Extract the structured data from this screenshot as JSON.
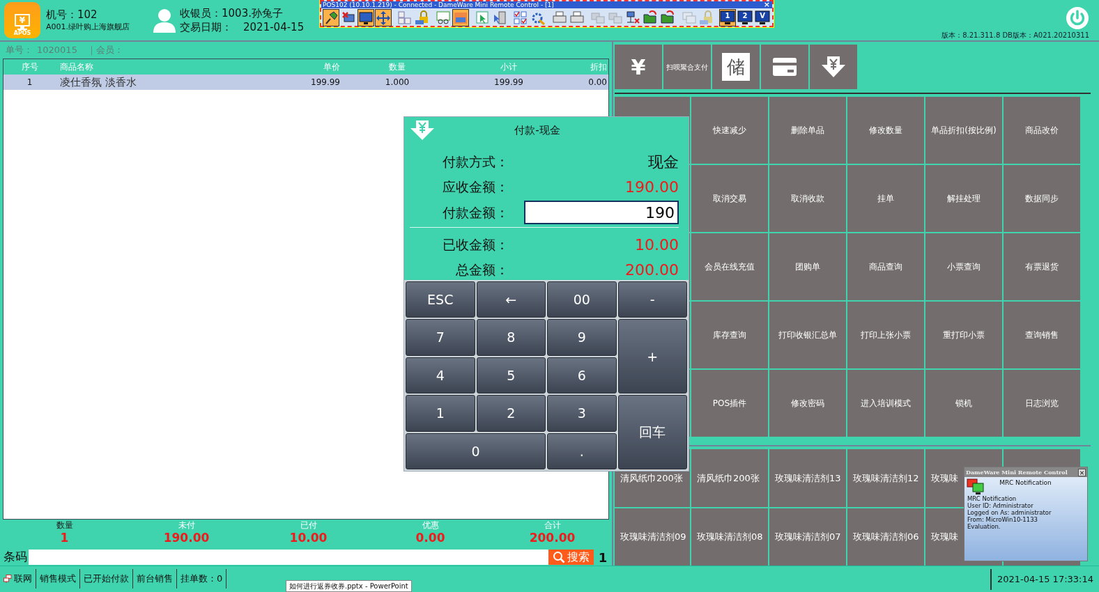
{
  "remote_control": {
    "title": "POS102 (10.10.1.219) - Connected - DameWare Mini Remote Control - [1]",
    "close": "×",
    "tools": [
      {
        "selected": true,
        "disabled": false
      },
      {
        "selected": false,
        "disabled": false
      },
      {
        "selected": true,
        "disabled": false
      },
      {
        "selected": true,
        "disabled": false
      },
      {
        "selected": false,
        "disabled": false
      },
      {
        "selected": false,
        "disabled": false
      },
      {
        "selected": false,
        "disabled": false
      },
      {
        "selected": true,
        "disabled": false
      },
      {
        "selected": false,
        "disabled": false
      },
      {
        "selected": false,
        "disabled": false
      },
      {
        "selected": false,
        "disabled": false
      },
      {
        "selected": false,
        "disabled": false
      },
      {
        "selected": false,
        "disabled": false
      },
      {
        "selected": false,
        "disabled": false
      },
      {
        "selected": false,
        "disabled": true
      },
      {
        "selected": false,
        "disabled": true
      },
      {
        "selected": false,
        "disabled": false
      },
      {
        "selected": false,
        "disabled": false
      },
      {
        "selected": false,
        "disabled": false
      },
      {
        "selected": false,
        "disabled": true
      },
      {
        "selected": false,
        "disabled": true
      },
      {
        "selected": true,
        "disabled": false,
        "label": "1"
      },
      {
        "selected": false,
        "disabled": false,
        "label": "2"
      },
      {
        "selected": false,
        "disabled": false,
        "label": "V"
      }
    ]
  },
  "header": {
    "logo_symbol": "¥",
    "logo_text": "APOS",
    "machine": "机号：102",
    "store": "A001.绿叶购上海旗舰店",
    "cashier": "收银员：1003.孙兔子",
    "date_label": "交易日期：",
    "date": "2021-04-15",
    "version": "版本：8.21.311.8 DB版本：A021.20210311"
  },
  "order": {
    "number_label": "单号：",
    "number": "1020015",
    "member_label": "｜会员："
  },
  "table": {
    "columns": [
      "序号",
      "商品名称",
      "单价",
      "数量",
      "小计",
      "折扣"
    ],
    "rows": [
      {
        "cells": [
          "1",
          "凌仕香氛 淡香水",
          "199.99",
          "1.000",
          "199.99",
          "0.00"
        ],
        "selected": true
      }
    ]
  },
  "totals": [
    {
      "label": "数量",
      "value": "1"
    },
    {
      "label": "未付",
      "value": "190.00"
    },
    {
      "label": "已付",
      "value": "10.00"
    },
    {
      "label": "优惠",
      "value": "0.00"
    },
    {
      "label": "合计",
      "value": "200.00"
    }
  ],
  "barcode": {
    "label": "条码",
    "search": "搜索",
    "count": "1"
  },
  "payment_methods": [
    {
      "kind": "glyph",
      "label": "¥"
    },
    {
      "kind": "text",
      "label": "扫呗聚合支付"
    },
    {
      "kind": "tile",
      "label": "储"
    },
    {
      "kind": "card"
    },
    {
      "kind": "download"
    }
  ],
  "functions": [
    [
      "快速减少",
      "删除单品",
      "修改数量",
      "单品折扣(按比例)",
      "商品改价"
    ],
    [
      "取消交易",
      "取消收款",
      "挂单",
      "解挂处理",
      "数据同步"
    ],
    [
      "会员在线充值",
      "团购单",
      "商品查询",
      "小票查询",
      "有票退货"
    ],
    [
      "库存查询",
      "打印收银汇总单",
      "打印上张小票",
      "重打印小票",
      "查询销售"
    ],
    [
      "POS插件",
      "修改密码",
      "进入培训模式",
      "锁机",
      "日志浏览"
    ]
  ],
  "products": [
    [
      "清风纸巾200张",
      "清风纸巾200张",
      "玫瑰味清洁剂13",
      "玫瑰味清洁剂12",
      "玫瑰味"
    ],
    [
      "玫瑰味清洁剂09",
      "玫瑰味清洁剂08",
      "玫瑰味清洁剂07",
      "玫瑰味清洁剂06",
      "玫瑰味"
    ]
  ],
  "payment_dialog": {
    "title": "付款-现金",
    "fields": [
      {
        "kind": "text",
        "label": "付款方式：",
        "value": "现金"
      },
      {
        "kind": "amount",
        "label": "应收金额：",
        "value": "190.00"
      },
      {
        "kind": "input",
        "label": "付款金额：",
        "value": "190"
      },
      {
        "kind": "divider"
      },
      {
        "kind": "amount",
        "label": "已收金额：",
        "value": "10.00"
      },
      {
        "kind": "amount",
        "label": "总金额：",
        "value": "200.00"
      }
    ],
    "keys": [
      {
        "label": "ESC",
        "kind": "normal"
      },
      {
        "label": "←",
        "kind": "normal"
      },
      {
        "label": "00",
        "kind": "normal"
      },
      {
        "label": "-",
        "kind": "normal"
      },
      {
        "label": "7",
        "kind": "normal"
      },
      {
        "label": "8",
        "kind": "normal"
      },
      {
        "label": "9",
        "kind": "normal"
      },
      {
        "label": "+",
        "kind": "tall"
      },
      {
        "label": "4",
        "kind": "normal"
      },
      {
        "label": "5",
        "kind": "normal"
      },
      {
        "label": "6",
        "kind": "normal"
      },
      {
        "label": "1",
        "kind": "normal"
      },
      {
        "label": "2",
        "kind": "normal"
      },
      {
        "label": "3",
        "kind": "normal"
      },
      {
        "label": "回车",
        "kind": "tall"
      },
      {
        "label": "0",
        "kind": "wide"
      },
      {
        "label": ".",
        "kind": "normal"
      }
    ]
  },
  "notification": {
    "title": "DameWare Mini Remote Control",
    "close": "×",
    "heading": "MRC Notification",
    "lines": [
      "MRC Notification",
      "User ID: Administrator",
      "Logged on As: administrator",
      "From: MicroWin10-1133",
      "Evaluation."
    ]
  },
  "status_bar": {
    "items": [
      {
        "kind": "network",
        "label": "联网"
      },
      {
        "kind": "plain",
        "label": "销售模式"
      },
      {
        "kind": "plain",
        "label": "已开始付款"
      },
      {
        "kind": "plain",
        "label": "前台销售"
      },
      {
        "kind": "plain",
        "label": "挂单数：0"
      }
    ],
    "datetime": "2021-04-15 17:33:14"
  },
  "tooltip": "如何进行返券收券.pptx - PowerPoint"
}
